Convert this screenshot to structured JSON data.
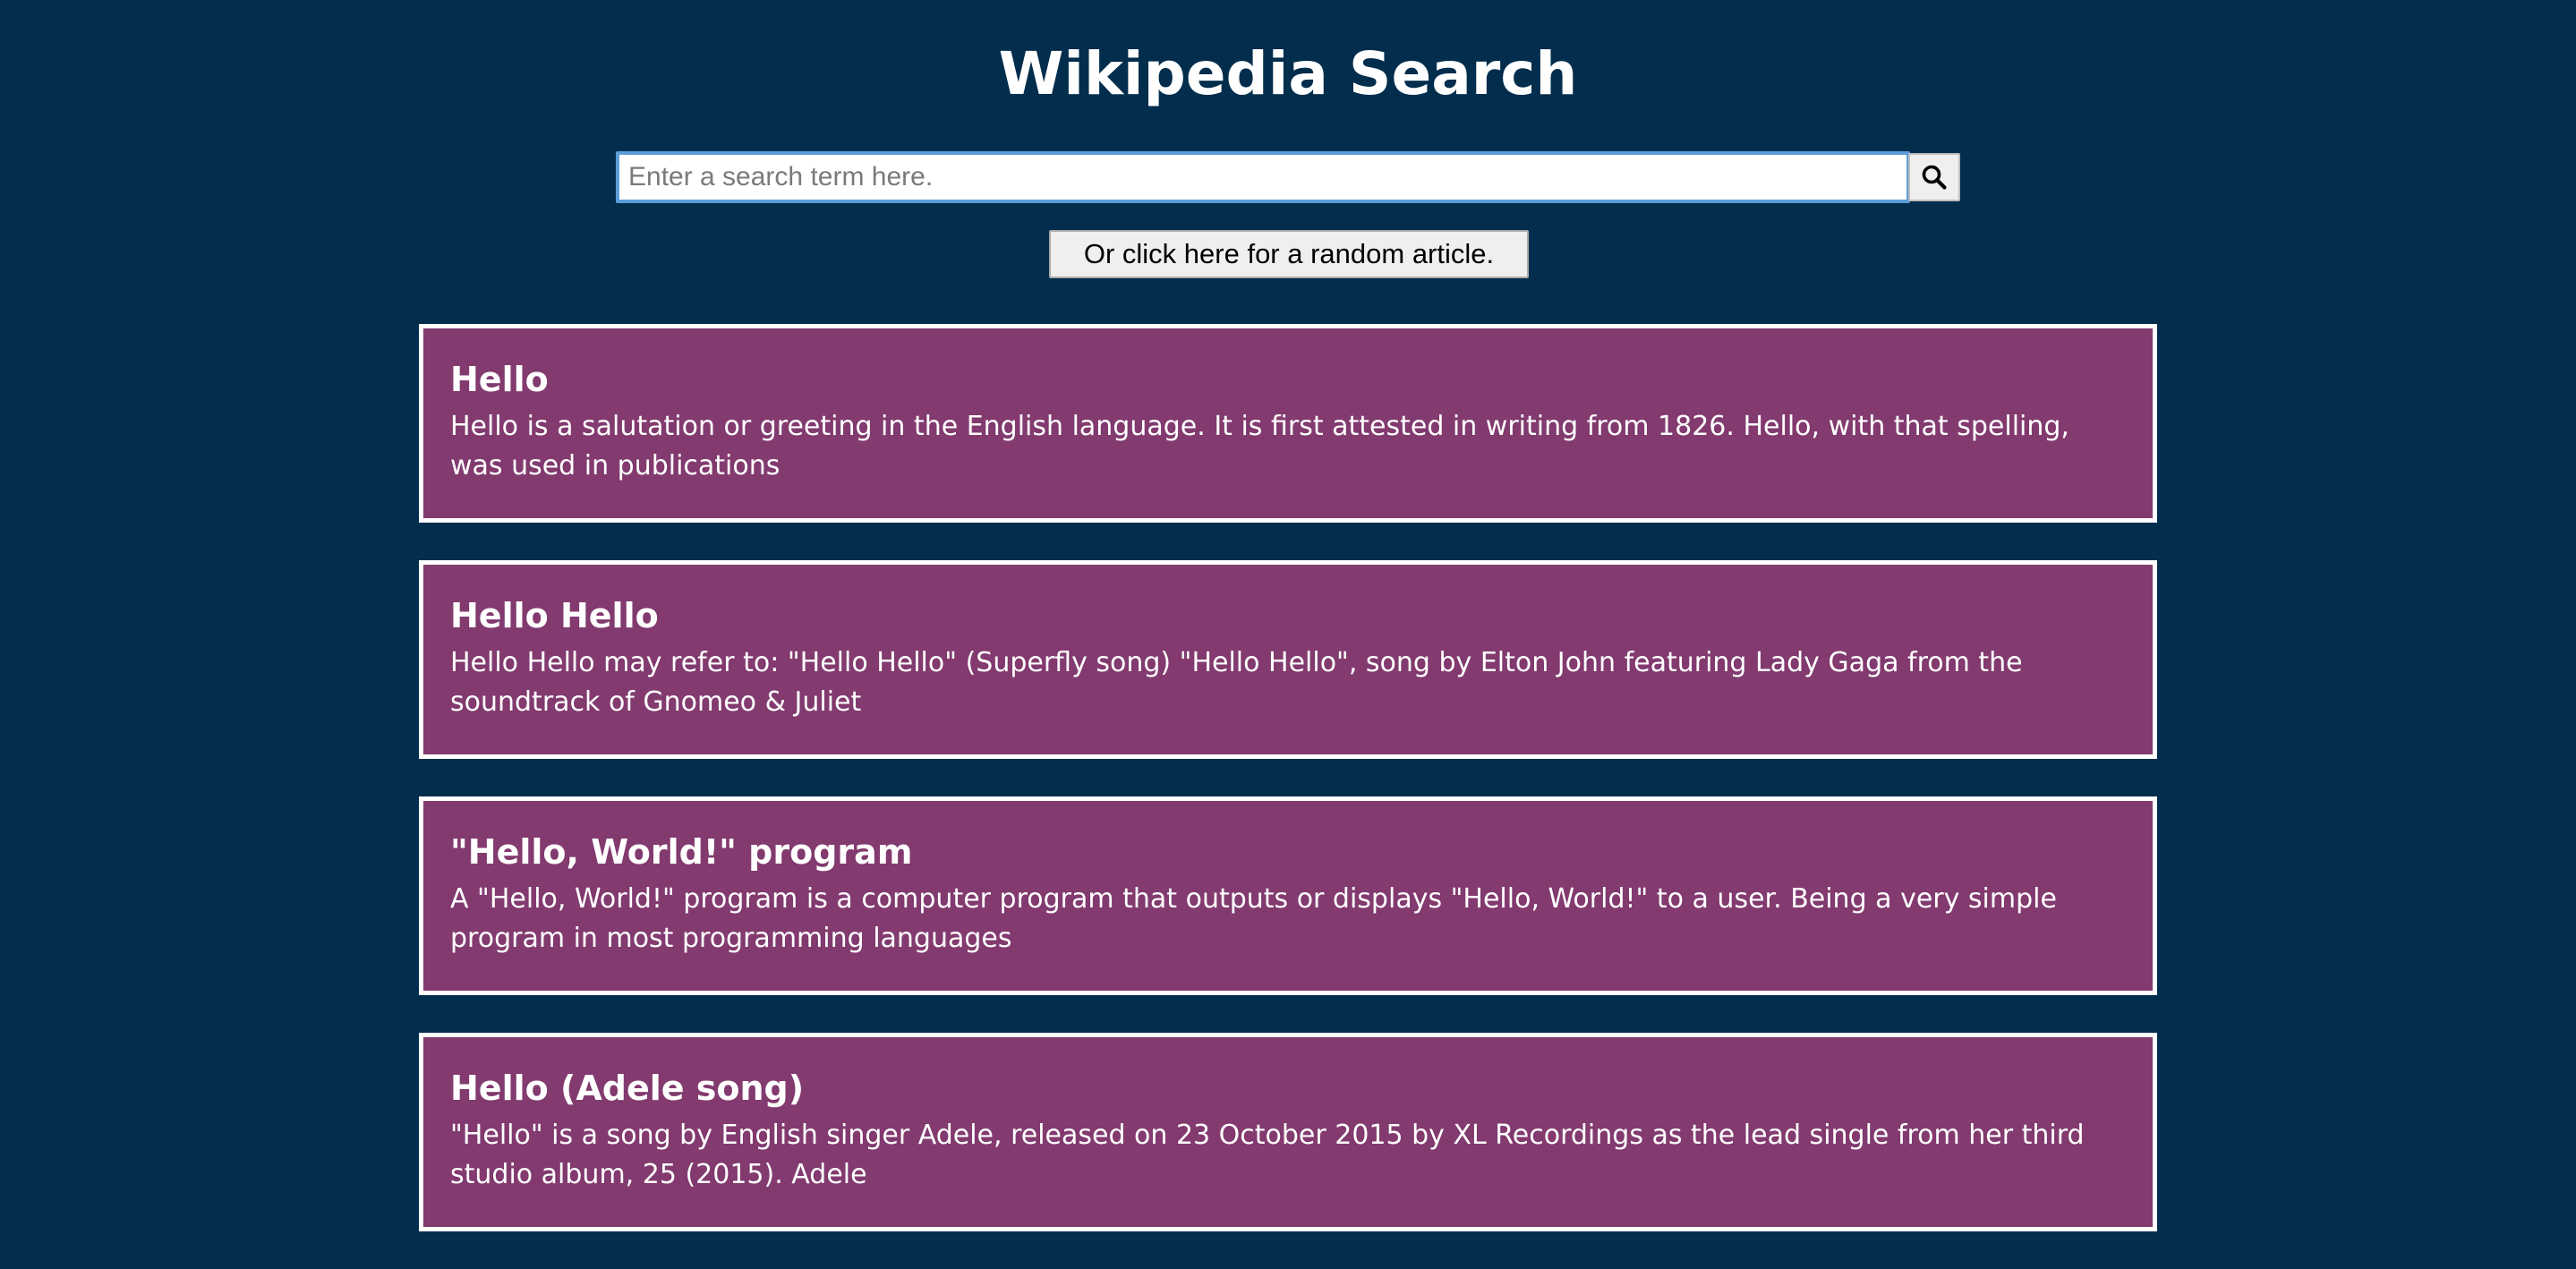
{
  "header": {
    "title": "Wikipedia Search"
  },
  "search": {
    "placeholder": "Enter a search term here.",
    "value": "",
    "button_icon": "search-icon"
  },
  "random": {
    "label": "Or click here for a random article."
  },
  "results": [
    {
      "title": "Hello",
      "snippet": "Hello is a salutation or greeting in the English language. It is first attested in writing from 1826. Hello, with that spelling, was used in publications"
    },
    {
      "title": "Hello Hello",
      "snippet": "Hello Hello may refer to: \"Hello Hello\" (Superfly song) \"Hello Hello\", song by Elton John featuring Lady Gaga from the soundtrack of Gnomeo & Juliet"
    },
    {
      "title": "\"Hello, World!\" program",
      "snippet": "A \"Hello, World!\" program is a computer program that outputs or displays \"Hello, World!\" to a user. Being a very simple program in most programming languages"
    },
    {
      "title": "Hello (Adele song)",
      "snippet": "\"Hello\" is a song by English singer Adele, released on 23 October 2015 by XL Recordings as the lead single from her third studio album, 25 (2015). Adele"
    }
  ],
  "colors": {
    "background": "#022d4d",
    "card": "#823a6f",
    "card_border": "#ffffff",
    "text": "#ffffff",
    "focus_ring": "#5b9dd9"
  }
}
